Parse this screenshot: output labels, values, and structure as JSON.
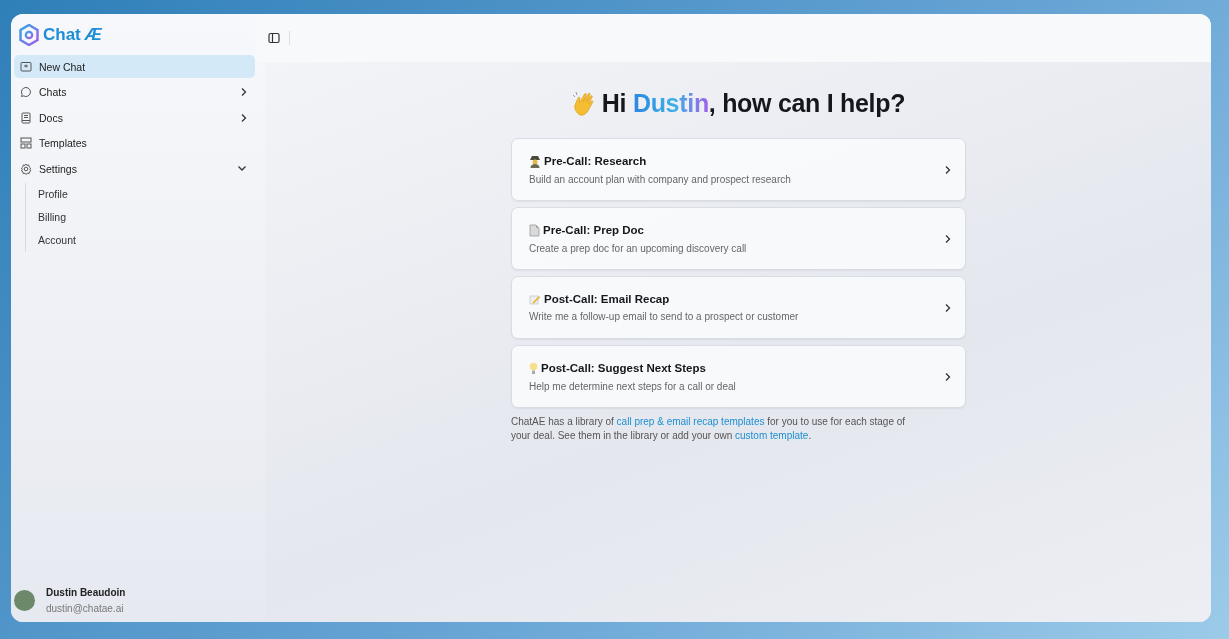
{
  "brand": {
    "name": "Chat",
    "mark": "Æ"
  },
  "sidebar": {
    "items": [
      {
        "label": "New Chat",
        "selected": true
      },
      {
        "label": "Chats",
        "selected": false,
        "expanded": false
      },
      {
        "label": "Docs",
        "selected": false,
        "expanded": false
      },
      {
        "label": "Templates",
        "selected": false
      },
      {
        "label": "Settings",
        "selected": false,
        "expanded": true,
        "children": [
          {
            "label": "Profile",
            "selected": false
          },
          {
            "label": "Billing",
            "selected": false
          },
          {
            "label": "Account",
            "selected": false
          }
        ]
      }
    ]
  },
  "user": {
    "name": "Dustin Beaudoin",
    "email": "dustin@chatae.ai"
  },
  "greeting": {
    "before": "Hi ",
    "name": "Dustin",
    "after": ", how can I help?"
  },
  "cards": [
    {
      "title": "Pre-Call: Research",
      "description": "Build an account plan with company and prospect research"
    },
    {
      "title": "Pre-Call: Prep Doc",
      "description": "Create a prep doc for an upcoming discovery call"
    },
    {
      "title": "Post-Call: Email Recap",
      "description": "Write me a follow-up email to send to a prospect or customer"
    },
    {
      "title": "Post-Call: Suggest Next Steps",
      "description": "Help me determine next steps for a call or deal"
    }
  ],
  "footer_note": [
    {
      "kind": "text",
      "text": "ChatAE has a library of "
    },
    {
      "kind": "link",
      "text": "call prep & email recap templates"
    },
    {
      "kind": "text",
      "text": " for you to use for each stage of your deal. See them in the library or add your own "
    },
    {
      "kind": "link",
      "text": "custom template"
    },
    {
      "kind": "text",
      "text": "."
    }
  ]
}
